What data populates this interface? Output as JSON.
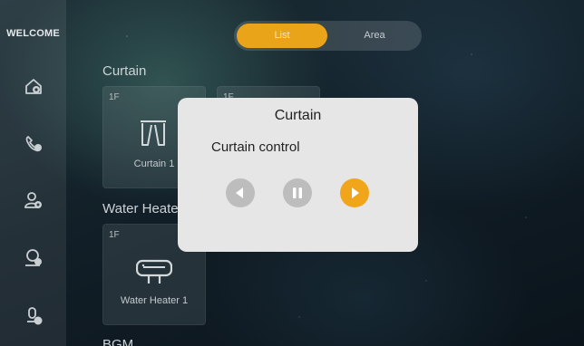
{
  "sidebar": {
    "welcome": "WELCOME",
    "items": [
      {
        "icon": "home-scene-icon"
      },
      {
        "icon": "phone-call-icon"
      },
      {
        "icon": "user-settings-icon"
      },
      {
        "icon": "user-status-icon"
      },
      {
        "icon": "user-music-icon"
      }
    ]
  },
  "tabs": [
    {
      "label": "List",
      "active": true
    },
    {
      "label": "Area",
      "active": false
    }
  ],
  "sections": [
    {
      "title": "Curtain",
      "cards": [
        {
          "floor": "1F",
          "name": "Curtain 1",
          "icon": "curtain-icon"
        },
        {
          "floor": "1F",
          "name": "",
          "icon": ""
        }
      ]
    },
    {
      "title": "Water Heater",
      "cards": [
        {
          "floor": "1F",
          "name": "Water Heater 1",
          "icon": "water-heater-icon"
        }
      ]
    },
    {
      "title": "BGM",
      "cards": []
    }
  ],
  "dialog": {
    "title": "Curtain",
    "subtitle": "Curtain control",
    "controls": [
      {
        "icon": "open-left-icon",
        "active": false
      },
      {
        "icon": "pause-icon",
        "active": false
      },
      {
        "icon": "close-right-icon",
        "active": true
      }
    ]
  },
  "colors": {
    "accent": "#e9a419",
    "control_idle": "#bdbdbd",
    "dialog_bg": "#e6e6e6"
  }
}
